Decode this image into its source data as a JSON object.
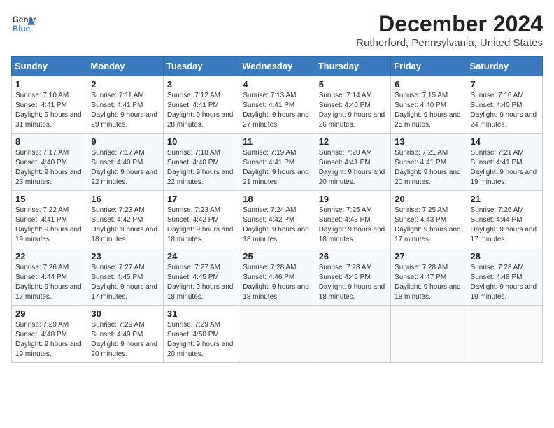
{
  "header": {
    "logo_line1": "General",
    "logo_line2": "Blue",
    "month_title": "December 2024",
    "location": "Rutherford, Pennsylvania, United States"
  },
  "weekdays": [
    "Sunday",
    "Monday",
    "Tuesday",
    "Wednesday",
    "Thursday",
    "Friday",
    "Saturday"
  ],
  "weeks": [
    [
      {
        "day": "1",
        "info": "Sunrise: 7:10 AM\nSunset: 4:41 PM\nDaylight: 9 hours and 31 minutes."
      },
      {
        "day": "2",
        "info": "Sunrise: 7:11 AM\nSunset: 4:41 PM\nDaylight: 9 hours and 29 minutes."
      },
      {
        "day": "3",
        "info": "Sunrise: 7:12 AM\nSunset: 4:41 PM\nDaylight: 9 hours and 28 minutes."
      },
      {
        "day": "4",
        "info": "Sunrise: 7:13 AM\nSunset: 4:41 PM\nDaylight: 9 hours and 27 minutes."
      },
      {
        "day": "5",
        "info": "Sunrise: 7:14 AM\nSunset: 4:40 PM\nDaylight: 9 hours and 26 minutes."
      },
      {
        "day": "6",
        "info": "Sunrise: 7:15 AM\nSunset: 4:40 PM\nDaylight: 9 hours and 25 minutes."
      },
      {
        "day": "7",
        "info": "Sunrise: 7:16 AM\nSunset: 4:40 PM\nDaylight: 9 hours and 24 minutes."
      }
    ],
    [
      {
        "day": "8",
        "info": "Sunrise: 7:17 AM\nSunset: 4:40 PM\nDaylight: 9 hours and 23 minutes."
      },
      {
        "day": "9",
        "info": "Sunrise: 7:17 AM\nSunset: 4:40 PM\nDaylight: 9 hours and 22 minutes."
      },
      {
        "day": "10",
        "info": "Sunrise: 7:18 AM\nSunset: 4:40 PM\nDaylight: 9 hours and 22 minutes."
      },
      {
        "day": "11",
        "info": "Sunrise: 7:19 AM\nSunset: 4:41 PM\nDaylight: 9 hours and 21 minutes."
      },
      {
        "day": "12",
        "info": "Sunrise: 7:20 AM\nSunset: 4:41 PM\nDaylight: 9 hours and 20 minutes."
      },
      {
        "day": "13",
        "info": "Sunrise: 7:21 AM\nSunset: 4:41 PM\nDaylight: 9 hours and 20 minutes."
      },
      {
        "day": "14",
        "info": "Sunrise: 7:21 AM\nSunset: 4:41 PM\nDaylight: 9 hours and 19 minutes."
      }
    ],
    [
      {
        "day": "15",
        "info": "Sunrise: 7:22 AM\nSunset: 4:41 PM\nDaylight: 9 hours and 19 minutes."
      },
      {
        "day": "16",
        "info": "Sunrise: 7:23 AM\nSunset: 4:42 PM\nDaylight: 9 hours and 18 minutes."
      },
      {
        "day": "17",
        "info": "Sunrise: 7:23 AM\nSunset: 4:42 PM\nDaylight: 9 hours and 18 minutes."
      },
      {
        "day": "18",
        "info": "Sunrise: 7:24 AM\nSunset: 4:42 PM\nDaylight: 9 hours and 18 minutes."
      },
      {
        "day": "19",
        "info": "Sunrise: 7:25 AM\nSunset: 4:43 PM\nDaylight: 9 hours and 18 minutes."
      },
      {
        "day": "20",
        "info": "Sunrise: 7:25 AM\nSunset: 4:43 PM\nDaylight: 9 hours and 17 minutes."
      },
      {
        "day": "21",
        "info": "Sunrise: 7:26 AM\nSunset: 4:44 PM\nDaylight: 9 hours and 17 minutes."
      }
    ],
    [
      {
        "day": "22",
        "info": "Sunrise: 7:26 AM\nSunset: 4:44 PM\nDaylight: 9 hours and 17 minutes."
      },
      {
        "day": "23",
        "info": "Sunrise: 7:27 AM\nSunset: 4:45 PM\nDaylight: 9 hours and 17 minutes."
      },
      {
        "day": "24",
        "info": "Sunrise: 7:27 AM\nSunset: 4:45 PM\nDaylight: 9 hours and 18 minutes."
      },
      {
        "day": "25",
        "info": "Sunrise: 7:28 AM\nSunset: 4:46 PM\nDaylight: 9 hours and 18 minutes."
      },
      {
        "day": "26",
        "info": "Sunrise: 7:28 AM\nSunset: 4:46 PM\nDaylight: 9 hours and 18 minutes."
      },
      {
        "day": "27",
        "info": "Sunrise: 7:28 AM\nSunset: 4:47 PM\nDaylight: 9 hours and 18 minutes."
      },
      {
        "day": "28",
        "info": "Sunrise: 7:28 AM\nSunset: 4:48 PM\nDaylight: 9 hours and 19 minutes."
      }
    ],
    [
      {
        "day": "29",
        "info": "Sunrise: 7:29 AM\nSunset: 4:48 PM\nDaylight: 9 hours and 19 minutes."
      },
      {
        "day": "30",
        "info": "Sunrise: 7:29 AM\nSunset: 4:49 PM\nDaylight: 9 hours and 20 minutes."
      },
      {
        "day": "31",
        "info": "Sunrise: 7:29 AM\nSunset: 4:50 PM\nDaylight: 9 hours and 20 minutes."
      },
      {
        "day": "",
        "info": ""
      },
      {
        "day": "",
        "info": ""
      },
      {
        "day": "",
        "info": ""
      },
      {
        "day": "",
        "info": ""
      }
    ]
  ]
}
